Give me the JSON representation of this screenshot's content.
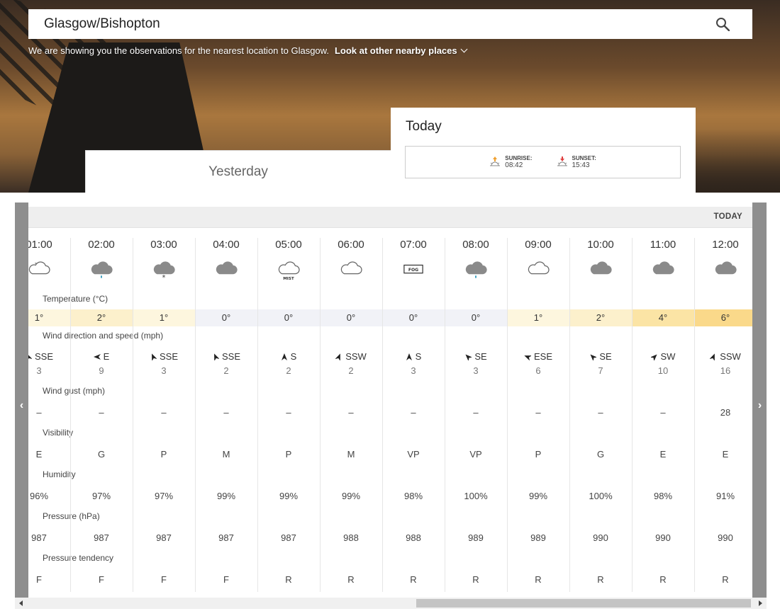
{
  "search": {
    "value": "Glasgow/Bishopton"
  },
  "nearest": {
    "message": "We are showing you the observations for the nearest location to Glasgow.",
    "link": "Look at other nearby places"
  },
  "tabs": {
    "yesterday": "Yesterday",
    "today": "Today",
    "sunrise_label": "SUNRISE:",
    "sunrise_time": "08:42",
    "sunset_label": "SUNSET:",
    "sunset_time": "15:43"
  },
  "table": {
    "day_label": "TODAY",
    "row_labels": {
      "temperature": "Temperature (°C)",
      "wind": "Wind direction and speed (mph)",
      "gust": "Wind gust (mph)",
      "visibility": "Visibility",
      "humidity": "Humidity",
      "pressure": "Pressure (hPa)",
      "tendency": "Pressure tendency"
    },
    "columns": [
      {
        "time": "01:00",
        "icon": "partly-cloudy-night-icon",
        "icon_text": "",
        "temp": "1°",
        "temp_color": "#fdf6de",
        "wind_dir": "SSE",
        "wind_deg": 337,
        "wind_speed": "3",
        "gust": "–",
        "visibility": "E",
        "humidity": "96%",
        "pressure": "987",
        "tendency": "F"
      },
      {
        "time": "02:00",
        "icon": "light-rain-icon",
        "icon_text": "",
        "temp": "2°",
        "temp_color": "#fcf0cc",
        "wind_dir": "E",
        "wind_deg": 270,
        "wind_speed": "9",
        "gust": "–",
        "visibility": "G",
        "humidity": "97%",
        "pressure": "987",
        "tendency": "F"
      },
      {
        "time": "03:00",
        "icon": "light-snow-icon",
        "icon_text": "",
        "temp": "1°",
        "temp_color": "#fdf6de",
        "wind_dir": "SSE",
        "wind_deg": 337,
        "wind_speed": "3",
        "gust": "–",
        "visibility": "P",
        "humidity": "97%",
        "pressure": "987",
        "tendency": "F"
      },
      {
        "time": "04:00",
        "icon": "overcast-icon",
        "icon_text": "",
        "temp": "0°",
        "temp_color": "#f1f2f7",
        "wind_dir": "SSE",
        "wind_deg": 337,
        "wind_speed": "2",
        "gust": "–",
        "visibility": "M",
        "humidity": "99%",
        "pressure": "987",
        "tendency": "F"
      },
      {
        "time": "05:00",
        "icon": "mist-icon",
        "icon_text": "MIST",
        "temp": "0°",
        "temp_color": "#f1f2f7",
        "wind_dir": "S",
        "wind_deg": 0,
        "wind_speed": "2",
        "gust": "–",
        "visibility": "P",
        "humidity": "99%",
        "pressure": "987",
        "tendency": "R"
      },
      {
        "time": "06:00",
        "icon": "cloudy-icon",
        "icon_text": "",
        "temp": "0°",
        "temp_color": "#f1f2f7",
        "wind_dir": "SSW",
        "wind_deg": 22,
        "wind_speed": "2",
        "gust": "–",
        "visibility": "M",
        "humidity": "99%",
        "pressure": "988",
        "tendency": "R"
      },
      {
        "time": "07:00",
        "icon": "fog-icon",
        "icon_text": "FOG",
        "temp": "0°",
        "temp_color": "#f1f2f7",
        "wind_dir": "S",
        "wind_deg": 0,
        "wind_speed": "3",
        "gust": "–",
        "visibility": "VP",
        "humidity": "98%",
        "pressure": "988",
        "tendency": "R"
      },
      {
        "time": "08:00",
        "icon": "light-rain-icon",
        "icon_text": "",
        "temp": "0°",
        "temp_color": "#f1f2f7",
        "wind_dir": "SE",
        "wind_deg": 315,
        "wind_speed": "3",
        "gust": "–",
        "visibility": "VP",
        "humidity": "100%",
        "pressure": "989",
        "tendency": "R"
      },
      {
        "time": "09:00",
        "icon": "cloudy-icon",
        "icon_text": "",
        "temp": "1°",
        "temp_color": "#fdf6de",
        "wind_dir": "ESE",
        "wind_deg": 292,
        "wind_speed": "6",
        "gust": "–",
        "visibility": "P",
        "humidity": "99%",
        "pressure": "989",
        "tendency": "R"
      },
      {
        "time": "10:00",
        "icon": "overcast-icon",
        "icon_text": "",
        "temp": "2°",
        "temp_color": "#fcf0cc",
        "wind_dir": "SE",
        "wind_deg": 315,
        "wind_speed": "7",
        "gust": "–",
        "visibility": "G",
        "humidity": "100%",
        "pressure": "990",
        "tendency": "R"
      },
      {
        "time": "11:00",
        "icon": "overcast-icon",
        "icon_text": "",
        "temp": "4°",
        "temp_color": "#fbe4a5",
        "wind_dir": "SW",
        "wind_deg": 45,
        "wind_speed": "10",
        "gust": "–",
        "visibility": "E",
        "humidity": "98%",
        "pressure": "990",
        "tendency": "R"
      },
      {
        "time": "12:00",
        "icon": "overcast-icon",
        "icon_text": "",
        "temp": "6°",
        "temp_color": "#fad98a",
        "wind_dir": "SSW",
        "wind_deg": 22,
        "wind_speed": "16",
        "gust": "28",
        "visibility": "E",
        "humidity": "91%",
        "pressure": "990",
        "tendency": "R"
      }
    ]
  },
  "colors": {
    "panel_gray": "#8e8e8e",
    "temp_last_strip": "#f4d172"
  },
  "nav": {
    "prev": "‹",
    "next": "›"
  }
}
